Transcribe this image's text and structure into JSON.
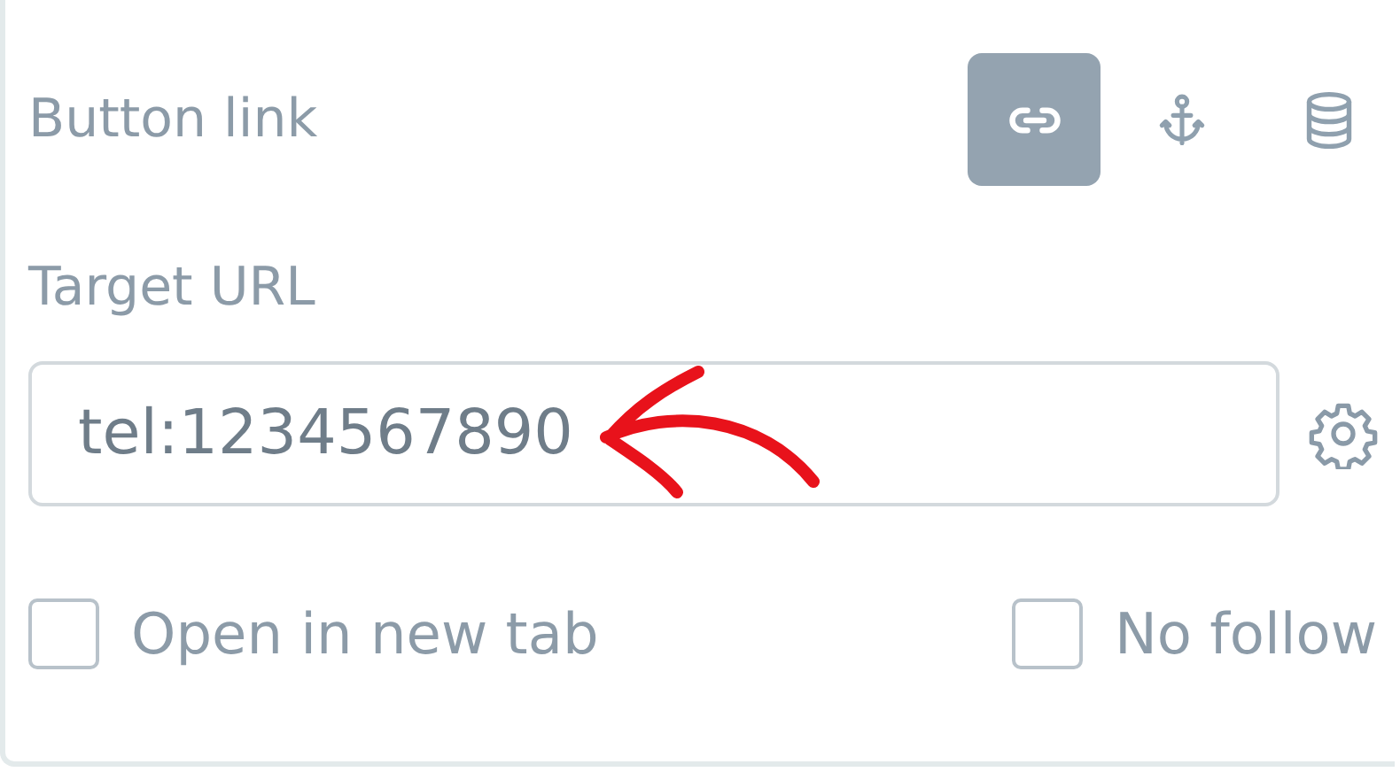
{
  "section_label": "Button link",
  "link_types": [
    {
      "kind": "link",
      "selected": true
    },
    {
      "kind": "anchor",
      "selected": false
    },
    {
      "kind": "database",
      "selected": false
    }
  ],
  "target_label": "Target URL",
  "url_field": {
    "value": "tel:1234567890"
  },
  "options": [
    {
      "label": "Open in new tab",
      "checked": false
    },
    {
      "label": "No follow",
      "checked": false
    }
  ]
}
